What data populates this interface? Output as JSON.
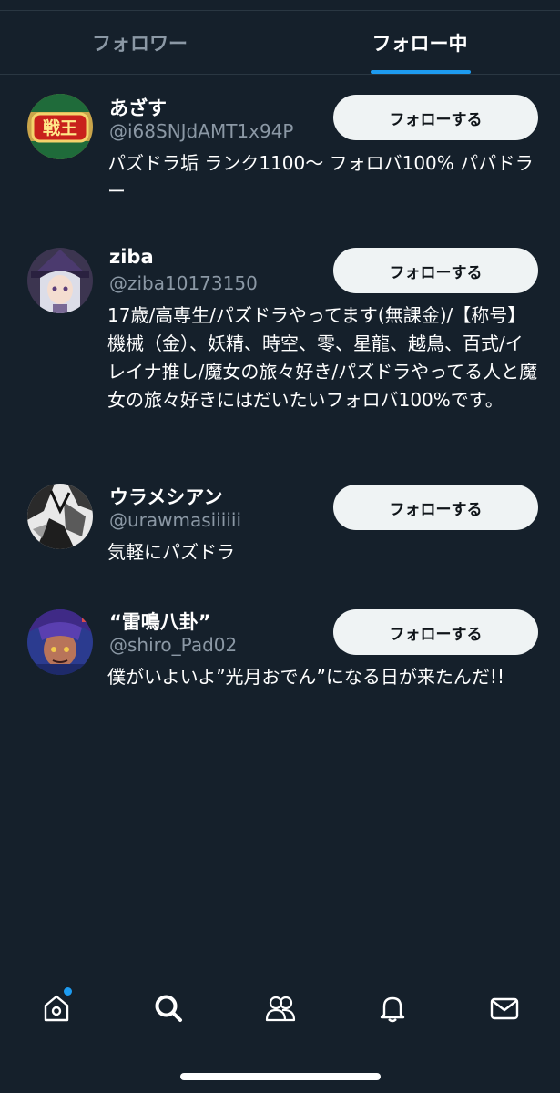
{
  "tabs": [
    {
      "label": "フォロワー",
      "active": false
    },
    {
      "label": "フォロー中",
      "active": true
    }
  ],
  "users": [
    {
      "name": "あざす",
      "handle": "@i68SNJdAMT1x94P",
      "bio": "パズドラ垢 ランク1100〜 フォロバ100% パパドラー",
      "button_label": "フォローする",
      "avatar_text": "戦王"
    },
    {
      "name": "ziba",
      "handle": "@ziba10173150",
      "bio": "17歳/高専生/パズドラやってます(無課金)/【称号】機械（金）、妖精、時空、零、星龍、越鳥、百式/イレイナ推し/魔女の旅々好き/パズドラやってる人と魔女の旅々好きにはだいたいフォロバ100%です。",
      "button_label": "フォローする"
    },
    {
      "name": "ウラメシアン",
      "handle": "@urawmasiiiiii",
      "bio": "気軽にパズドラ",
      "button_label": "フォローする"
    },
    {
      "name": "“雷鳴八卦”",
      "handle": "@shiro_Pad02",
      "bio": "僕がいよいよ”光月おでん”になる日が来たんだ!!",
      "button_label": "フォローする"
    }
  ],
  "nav": {
    "items": [
      "home-icon",
      "search-icon",
      "communities-icon",
      "notifications-icon",
      "messages-icon"
    ],
    "active": "search-icon",
    "home_has_notification_dot": true
  },
  "colors": {
    "background": "#15202b",
    "accent": "#1d9bf0",
    "secondary_text": "#8b98a5",
    "button_bg": "#eff3f4"
  }
}
